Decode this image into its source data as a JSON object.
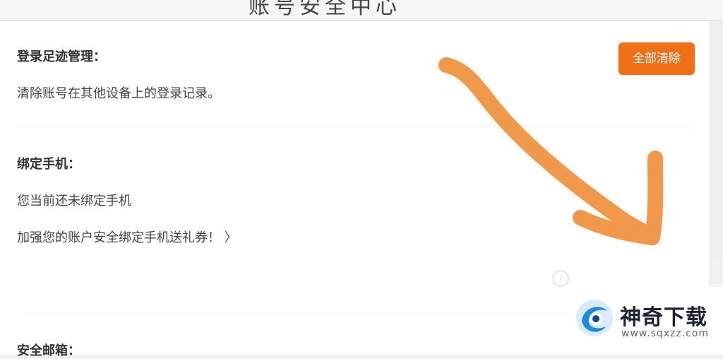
{
  "header": {
    "title": "账号安全中心"
  },
  "login_trace": {
    "title": "登录足迹管理：",
    "description": "清除账号在其他设备上的登录记录。",
    "clear_button": "全部清除"
  },
  "bind_phone": {
    "title": "绑定手机：",
    "status": "您当前还未绑定手机",
    "promo_link": "加强您的账户安全绑定手机送礼券！ 〉"
  },
  "faint_tip": "i  ...",
  "security_email": {
    "title": "安全邮箱："
  },
  "watermark": {
    "brand": "神奇下载",
    "url": "www.sqxzz.com"
  },
  "annotation": {
    "arrow_color": "#f0903c"
  }
}
